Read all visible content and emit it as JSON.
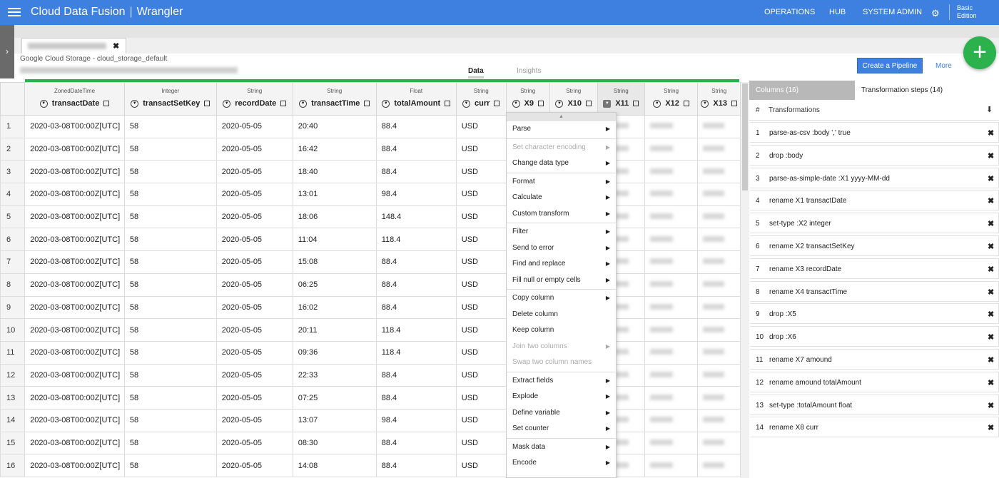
{
  "topbar": {
    "brand": "Cloud Data Fusion",
    "product": "Wrangler",
    "nav": [
      "OPERATIONS",
      "HUB",
      "SYSTEM ADMIN"
    ],
    "edition_line1": "Basic",
    "edition_line2": "Edition",
    "brand_color": "#3e80e0"
  },
  "header": {
    "source": "Google Cloud Storage - cloud_storage_default",
    "tabs": [
      "Data",
      "Insights"
    ],
    "create_pipeline": "Create a Pipeline",
    "more": "More",
    "fab_label": "+"
  },
  "columns": [
    {
      "type": "ZonedDateTime",
      "name": "transactDate"
    },
    {
      "type": "Integer",
      "name": "transactSetKey"
    },
    {
      "type": "String",
      "name": "recordDate"
    },
    {
      "type": "String",
      "name": "transactTime"
    },
    {
      "type": "Float",
      "name": "totalAmount"
    },
    {
      "type": "String",
      "name": "curr"
    },
    {
      "type": "String",
      "name": "X9"
    },
    {
      "type": "String",
      "name": "X10"
    },
    {
      "type": "String",
      "name": "X11"
    },
    {
      "type": "String",
      "name": "X12"
    },
    {
      "type": "String",
      "name": "X13"
    }
  ],
  "rows": [
    [
      "1",
      "2020-03-08T00:00Z[UTC]",
      "58",
      "2020-05-05",
      "20:40",
      "88.4",
      "USD"
    ],
    [
      "2",
      "2020-03-08T00:00Z[UTC]",
      "58",
      "2020-05-05",
      "16:42",
      "88.4",
      "USD"
    ],
    [
      "3",
      "2020-03-08T00:00Z[UTC]",
      "58",
      "2020-05-05",
      "18:40",
      "88.4",
      "USD"
    ],
    [
      "4",
      "2020-03-08T00:00Z[UTC]",
      "58",
      "2020-05-05",
      "13:01",
      "98.4",
      "USD"
    ],
    [
      "5",
      "2020-03-08T00:00Z[UTC]",
      "58",
      "2020-05-05",
      "18:06",
      "148.4",
      "USD"
    ],
    [
      "6",
      "2020-03-08T00:00Z[UTC]",
      "58",
      "2020-05-05",
      "11:04",
      "118.4",
      "USD"
    ],
    [
      "7",
      "2020-03-08T00:00Z[UTC]",
      "58",
      "2020-05-05",
      "15:08",
      "88.4",
      "USD"
    ],
    [
      "8",
      "2020-03-08T00:00Z[UTC]",
      "58",
      "2020-05-05",
      "06:25",
      "88.4",
      "USD"
    ],
    [
      "9",
      "2020-03-08T00:00Z[UTC]",
      "58",
      "2020-05-05",
      "16:02",
      "88.4",
      "USD"
    ],
    [
      "10",
      "2020-03-08T00:00Z[UTC]",
      "58",
      "2020-05-05",
      "20:11",
      "118.4",
      "USD"
    ],
    [
      "11",
      "2020-03-08T00:00Z[UTC]",
      "58",
      "2020-05-05",
      "09:36",
      "118.4",
      "USD"
    ],
    [
      "12",
      "2020-03-08T00:00Z[UTC]",
      "58",
      "2020-05-05",
      "22:33",
      "88.4",
      "USD"
    ],
    [
      "13",
      "2020-03-08T00:00Z[UTC]",
      "58",
      "2020-05-05",
      "07:25",
      "88.4",
      "USD"
    ],
    [
      "14",
      "2020-03-08T00:00Z[UTC]",
      "58",
      "2020-05-05",
      "13:07",
      "98.4",
      "USD"
    ],
    [
      "15",
      "2020-03-08T00:00Z[UTC]",
      "58",
      "2020-05-05",
      "08:30",
      "88.4",
      "USD"
    ],
    [
      "16",
      "2020-03-08T00:00Z[UTC]",
      "58",
      "2020-05-05",
      "14:08",
      "88.4",
      "USD"
    ]
  ],
  "context_menu": [
    {
      "label": "Parse",
      "sub": true,
      "disabled": false,
      "sep_before": false
    },
    {
      "label": "Set character encoding",
      "sub": true,
      "disabled": true,
      "sep_before": true
    },
    {
      "label": "Change data type",
      "sub": true,
      "disabled": false,
      "sep_before": false
    },
    {
      "label": "Format",
      "sub": true,
      "disabled": false,
      "sep_before": true
    },
    {
      "label": "Calculate",
      "sub": true,
      "disabled": false,
      "sep_before": false
    },
    {
      "label": "Custom transform",
      "sub": true,
      "disabled": false,
      "sep_before": false
    },
    {
      "label": "Filter",
      "sub": true,
      "disabled": false,
      "sep_before": true
    },
    {
      "label": "Send to error",
      "sub": true,
      "disabled": false,
      "sep_before": false
    },
    {
      "label": "Find and replace",
      "sub": true,
      "disabled": false,
      "sep_before": false
    },
    {
      "label": "Fill null or empty cells",
      "sub": true,
      "disabled": false,
      "sep_before": false
    },
    {
      "label": "Copy column",
      "sub": true,
      "disabled": false,
      "sep_before": true
    },
    {
      "label": "Delete column",
      "sub": false,
      "disabled": false,
      "sep_before": false
    },
    {
      "label": "Keep column",
      "sub": false,
      "disabled": false,
      "sep_before": false
    },
    {
      "label": "Join two columns",
      "sub": true,
      "disabled": true,
      "sep_before": false
    },
    {
      "label": "Swap two column names",
      "sub": false,
      "disabled": true,
      "sep_before": false
    },
    {
      "label": "Extract fields",
      "sub": true,
      "disabled": false,
      "sep_before": true
    },
    {
      "label": "Explode",
      "sub": true,
      "disabled": false,
      "sep_before": false
    },
    {
      "label": "Define variable",
      "sub": true,
      "disabled": false,
      "sep_before": false
    },
    {
      "label": "Set counter",
      "sub": true,
      "disabled": false,
      "sep_before": false
    },
    {
      "label": "Mask data",
      "sub": true,
      "disabled": false,
      "sep_before": true
    },
    {
      "label": "Encode",
      "sub": true,
      "disabled": false,
      "sep_before": false
    }
  ],
  "right_panel": {
    "tab_columns": "Columns (16)",
    "tab_steps": "Transformation steps (14)",
    "hash": "#",
    "heading": "Transformations",
    "steps": [
      {
        "n": "1",
        "text": "parse-as-csv :body ',' true"
      },
      {
        "n": "2",
        "text": "drop :body"
      },
      {
        "n": "3",
        "text": "parse-as-simple-date :X1 yyyy-MM-dd"
      },
      {
        "n": "4",
        "text": "rename X1 transactDate"
      },
      {
        "n": "5",
        "text": "set-type :X2 integer"
      },
      {
        "n": "6",
        "text": "rename X2 transactSetKey"
      },
      {
        "n": "7",
        "text": "rename X3 recordDate"
      },
      {
        "n": "8",
        "text": "rename X4 transactTime"
      },
      {
        "n": "9",
        "text": "drop :X5"
      },
      {
        "n": "10",
        "text": "drop :X6"
      },
      {
        "n": "11",
        "text": "rename X7 amound"
      },
      {
        "n": "12",
        "text": "rename amound totalAmount"
      },
      {
        "n": "13",
        "text": "set-type :totalAmount float"
      },
      {
        "n": "14",
        "text": "rename X8 curr"
      }
    ]
  }
}
